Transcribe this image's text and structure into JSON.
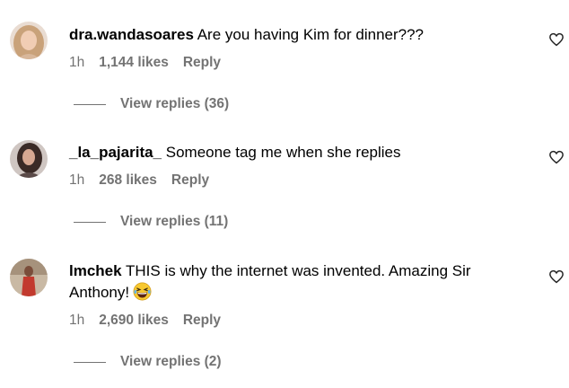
{
  "colors": {
    "text": "#000000",
    "muted": "#737373",
    "background": "#ffffff"
  },
  "comments": [
    {
      "username": "dra.wandasoares",
      "text": "Are you having Kim for dinner???",
      "time": "1h",
      "likes": "1,144 likes",
      "reply_label": "Reply",
      "view_replies": "View replies (36)",
      "heart_icon": "heart-outline-icon"
    },
    {
      "username": "_la_pajarita_",
      "text": "Someone tag me when she replies",
      "time": "1h",
      "likes": "268 likes",
      "reply_label": "Reply",
      "view_replies": "View replies (11)",
      "heart_icon": "heart-outline-icon"
    },
    {
      "username": "lmchek",
      "text": "THIS is why the internet was invented. Amazing Sir Anthony!",
      "emoji": "grinning-squinting-tears-emoji",
      "time": "1h",
      "likes": "2,690 likes",
      "reply_label": "Reply",
      "view_replies": "View replies (2)",
      "heart_icon": "heart-outline-icon"
    }
  ]
}
